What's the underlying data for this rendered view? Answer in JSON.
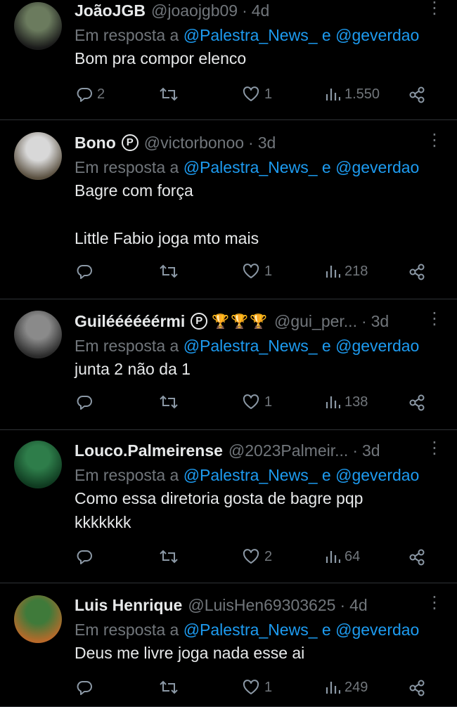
{
  "reply_prefix": "Em resposta a",
  "reply_joiner": "e",
  "tweets": [
    {
      "name": "JoãoJGB",
      "verified": false,
      "trophies": "",
      "handle": "@joaojgb09",
      "time": "4d",
      "mention1": "@Palestra_News_",
      "mention2": "@geverdao",
      "text": "Bom pra compor elenco",
      "replies": "2",
      "retweets": "",
      "likes": "1",
      "views": "1.550",
      "avatar_colors": [
        "#6b7b5e",
        "#1a1a1a"
      ]
    },
    {
      "name": "Bono",
      "verified": true,
      "trophies": "",
      "handle": "@victorbonoo",
      "time": "3d",
      "mention1": "@Palestra_News_",
      "mention2": "@geverdao",
      "text": "Bagre com força\n\nLittle Fabio joga mto mais",
      "replies": "",
      "retweets": "",
      "likes": "1",
      "views": "218",
      "avatar_colors": [
        "#d8d8d8",
        "#5a5040"
      ]
    },
    {
      "name": "Guiléééééérmi",
      "verified": true,
      "trophies": "🏆🏆🏆",
      "handle": "@gui_per...",
      "time": "3d",
      "mention1": "@Palestra_News_",
      "mention2": "@geverdao",
      "text": "junta 2 não da 1",
      "replies": "",
      "retweets": "",
      "likes": "1",
      "views": "138",
      "avatar_colors": [
        "#8a8a8a",
        "#2a2a2a"
      ]
    },
    {
      "name": "Louco.Palmeirense",
      "verified": false,
      "trophies": "",
      "handle": "@2023Palmeir...",
      "time": "3d",
      "mention1": "@Palestra_News_",
      "mention2": "@geverdao",
      "text": "Como essa diretoria gosta de bagre pqp\nkkkkkkk",
      "replies": "",
      "retweets": "",
      "likes": "2",
      "views": "64",
      "avatar_colors": [
        "#2e7d4a",
        "#0f3a20"
      ]
    },
    {
      "name": "Luis Henrique",
      "verified": false,
      "trophies": "",
      "handle": "@LuisHen69303625",
      "time": "4d",
      "mention1": "@Palestra_News_",
      "mention2": "@geverdao",
      "text": "Deus me livre joga nada esse ai",
      "replies": "",
      "retweets": "",
      "likes": "1",
      "views": "249",
      "avatar_colors": [
        "#3f7a3a",
        "#b86a2a"
      ]
    }
  ]
}
